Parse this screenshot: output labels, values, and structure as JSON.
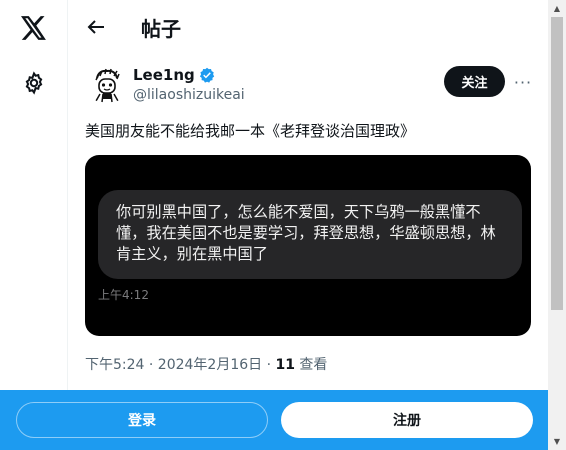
{
  "header": {
    "title": "帖子"
  },
  "post": {
    "author_name": "Lee1ng",
    "author_handle": "@lilaoshizuikeai",
    "follow_label": "关注",
    "more_label": "···",
    "text": "美国朋友能不能给我邮一本《老拜登谈治国理政》",
    "image": {
      "bubble_text": "你可别黑中国了，怎么能不爱国，天下乌鸦一般黑懂不懂，我在美国不也是要学习，拜登思想，华盛顿思想，林肯主义，别在黑中国了",
      "bubble_time": "上午4:12"
    },
    "meta_time": "下午5:24 · 2024年2月16日 · ",
    "meta_views_count": "11",
    "meta_views_label": " 查看"
  },
  "bottom_bar": {
    "login_label": "登录",
    "signup_label": "注册"
  },
  "colors": {
    "accent": "#1d9bf0",
    "verified": "#1d9bf0",
    "text": "#0f1419",
    "muted": "#536471"
  },
  "icons": [
    "x-logo-icon",
    "gear-icon",
    "back-arrow-icon",
    "verified-badge-icon",
    "more-icon"
  ]
}
